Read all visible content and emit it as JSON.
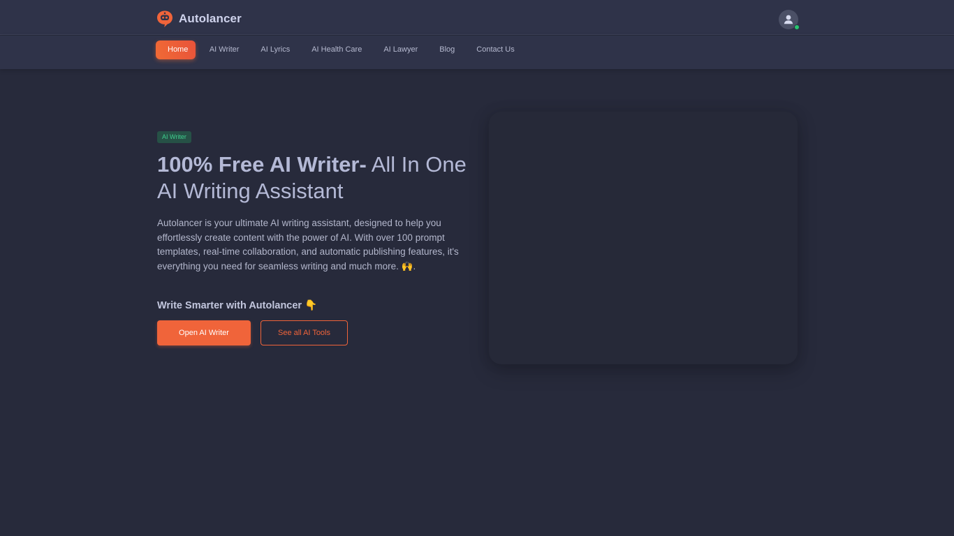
{
  "brand": {
    "name": "Autolancer",
    "logo_icon": "robot-chat-logo-icon",
    "accent_color": "#f0643a"
  },
  "user": {
    "avatar_icon": "user-avatar-icon",
    "status": "online",
    "status_color": "#28c76f"
  },
  "nav": {
    "items": [
      {
        "label": "Home",
        "active": true
      },
      {
        "label": "AI Writer",
        "active": false
      },
      {
        "label": "AI Lyrics",
        "active": false
      },
      {
        "label": "AI Health Care",
        "active": false
      },
      {
        "label": "AI Lawyer",
        "active": false
      },
      {
        "label": "Blog",
        "active": false
      },
      {
        "label": "Contact Us",
        "active": false
      }
    ]
  },
  "hero": {
    "badge": "AI Writer",
    "badge_color": "#3fcf8e",
    "headline_bold": "100% Free AI Writer-",
    "headline_rest": " All In One AI Writing Assistant",
    "description": "Autolancer is your ultimate AI writing assistant, designed to help you effortlessly create content with the power of AI. With over 100 prompt templates, real-time collaboration, and automatic publishing features, it's everything you need for seamless writing and much more. 🙌.",
    "cta_heading": "Write Smarter with Autolancer 👇",
    "primary_button": "Open AI Writer",
    "secondary_button": "See all AI Tools"
  }
}
